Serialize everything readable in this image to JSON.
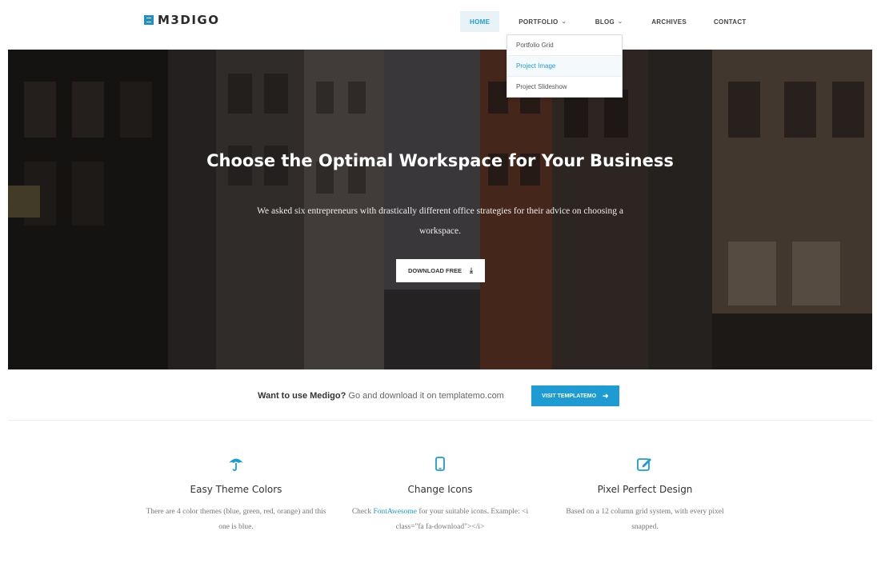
{
  "brand": {
    "name": "M3DIGO",
    "accent": "#1e9bd3"
  },
  "nav": {
    "items": [
      {
        "label": "HOME",
        "active": true
      },
      {
        "label": "PORTFOLIO",
        "has_caret": true
      },
      {
        "label": "BLOG",
        "has_caret": true
      },
      {
        "label": "ARCHIVES"
      },
      {
        "label": "CONTACT"
      }
    ],
    "dropdown": [
      "Portfolio Grid",
      "Project Image",
      "Project Slideshow"
    ]
  },
  "hero": {
    "title": "Choose the Optimal Workspace for Your Business",
    "subtitle": "We asked six entrepreneurs with drastically different office strategies for their advice on choosing a workspace.",
    "button_label": "DOWNLOAD FREE",
    "button_icon": "download-icon"
  },
  "callout": {
    "bold": "Want to use Medigo?",
    "rest": " Go and download it on templatemo.com",
    "button_label": "VISIT TEMPLATEMO",
    "button_icon": "arrow-right-icon"
  },
  "features": [
    {
      "icon": "umbrella-icon",
      "title": "Easy Theme Colors",
      "text": "There are 4 color themes (blue, green, red, orange) and this one is blue."
    },
    {
      "icon": "mobile-icon",
      "title": "Change Icons",
      "text_before": "Check ",
      "link": "FontAwesome",
      "text_after": " for your suitable icons. Example: <i class=\"fa fa-download\"></i>"
    },
    {
      "icon": "edit-icon",
      "title": "Pixel Perfect Design",
      "text": "Based on a 12 column grid system, with every pixel snapped."
    }
  ]
}
